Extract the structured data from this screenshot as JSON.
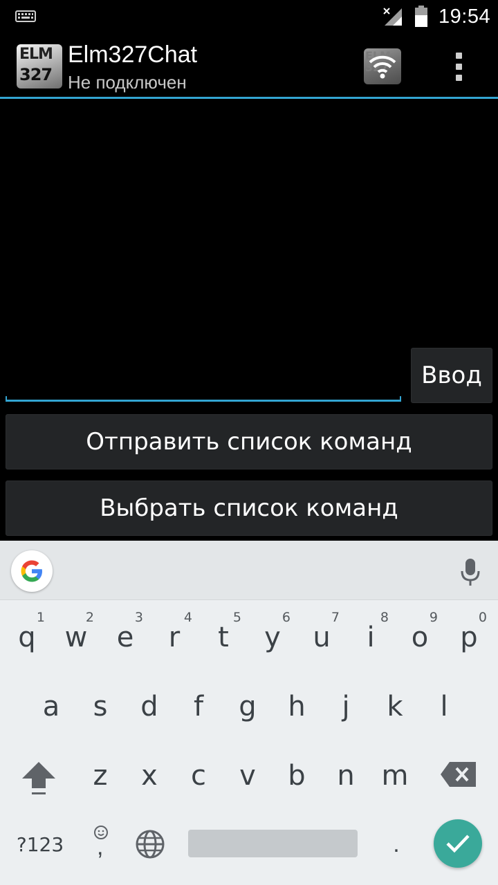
{
  "status_bar": {
    "time": "19:54",
    "icons": [
      "keyboard-icon",
      "signal-icon",
      "battery-icon"
    ]
  },
  "action_bar": {
    "logo_line1": "ELM",
    "logo_line2": "327",
    "title": "Elm327Chat",
    "subtitle": "Не подключен",
    "wifi_ghost_line1": "ELM",
    "wifi_ghost_line2": "327",
    "icons": [
      "wifi-icon",
      "overflow-menu-icon"
    ],
    "accent_color": "#33a5d2"
  },
  "command": {
    "input_value": "",
    "enter_label": "Ввод"
  },
  "buttons": {
    "send_list": "Отправить список команд",
    "select_list": "Выбрать список команд"
  },
  "keyboard": {
    "row1": [
      {
        "key": "q",
        "hint": "1"
      },
      {
        "key": "w",
        "hint": "2"
      },
      {
        "key": "e",
        "hint": "3"
      },
      {
        "key": "r",
        "hint": "4"
      },
      {
        "key": "t",
        "hint": "5"
      },
      {
        "key": "y",
        "hint": "6"
      },
      {
        "key": "u",
        "hint": "7"
      },
      {
        "key": "i",
        "hint": "8"
      },
      {
        "key": "o",
        "hint": "9"
      },
      {
        "key": "p",
        "hint": "0"
      }
    ],
    "row2": [
      "a",
      "s",
      "d",
      "f",
      "g",
      "h",
      "j",
      "k",
      "l"
    ],
    "row3": [
      "z",
      "x",
      "c",
      "v",
      "b",
      "n",
      "m"
    ],
    "symbols_label": "?123",
    "period": ".",
    "emoji_comma": ",",
    "icons": [
      "google-icon",
      "mic-icon",
      "shift-icon",
      "backspace-icon",
      "emoji-icon",
      "globe-icon",
      "check-icon"
    ],
    "enter_color": "#3aa99a"
  }
}
